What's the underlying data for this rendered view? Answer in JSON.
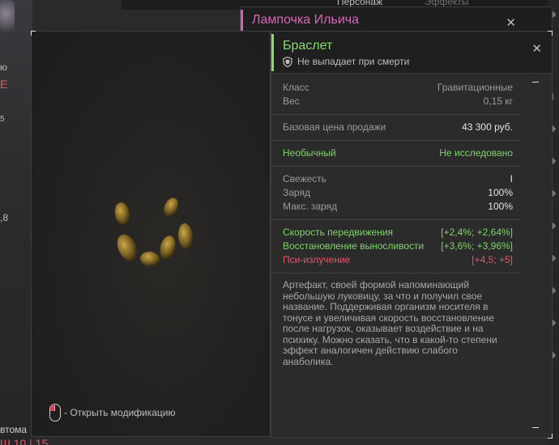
{
  "background": {
    "left_fragments": [
      "ю",
      "Е",
      "5",
      ",8"
    ],
    "top_tabs": [
      "Персонаж",
      "Эффекты"
    ],
    "bottom_fragments": [
      "втома",
      "Ш 10 | 15"
    ]
  },
  "back_window": {
    "title": "Лампочка Ильича",
    "close_icon": "close-icon"
  },
  "preview": {
    "artifact": "bracelet-artifact-image",
    "hint_text": "- Открыть модификацию",
    "hint_icon": "mouse-left-click-icon"
  },
  "item": {
    "name": "Браслет",
    "note": "Не выпадает при смерти",
    "note_icon": "shield-icon",
    "close_icon": "close-icon",
    "colors": {
      "name": "#86dc6e",
      "positive": "#7fd46a",
      "negative": "#e0586a",
      "back_title": "#d765b9"
    },
    "basic": [
      {
        "label": "Класс",
        "value": "Гравитационные"
      },
      {
        "label": "Вес",
        "value": "0,15 кг"
      }
    ],
    "price": {
      "label": "Базовая цена продажи",
      "value": "43 300 руб."
    },
    "rarity": {
      "label": "Необычный",
      "value": "Не исследовано"
    },
    "state": [
      {
        "label": "Свежесть",
        "value": "I"
      },
      {
        "label": "Заряд",
        "value": "100%"
      },
      {
        "label": "Макс. заряд",
        "value": "100%"
      }
    ],
    "effects": [
      {
        "label": "Скорость передвижения",
        "value": "[+2,4%; +2,64%]",
        "kind": "positive"
      },
      {
        "label": "Восстановление выносливости",
        "value": "[+3,6%; +3,96%]",
        "kind": "positive"
      },
      {
        "label": "Пси-излучение",
        "value": "[+4,5; +5]",
        "kind": "negative"
      }
    ],
    "description": "Артефакт, своей формой напоминающий небольшую луковицу, за что и получил свое название. Поддерживая организм носителя в тонусе и увеличивая скорость восстановление после нагрузок, оказывает воздействие и на психику. Можно сказать, что в какой-то степени эффект аналогичен действию слабого анаболика."
  }
}
